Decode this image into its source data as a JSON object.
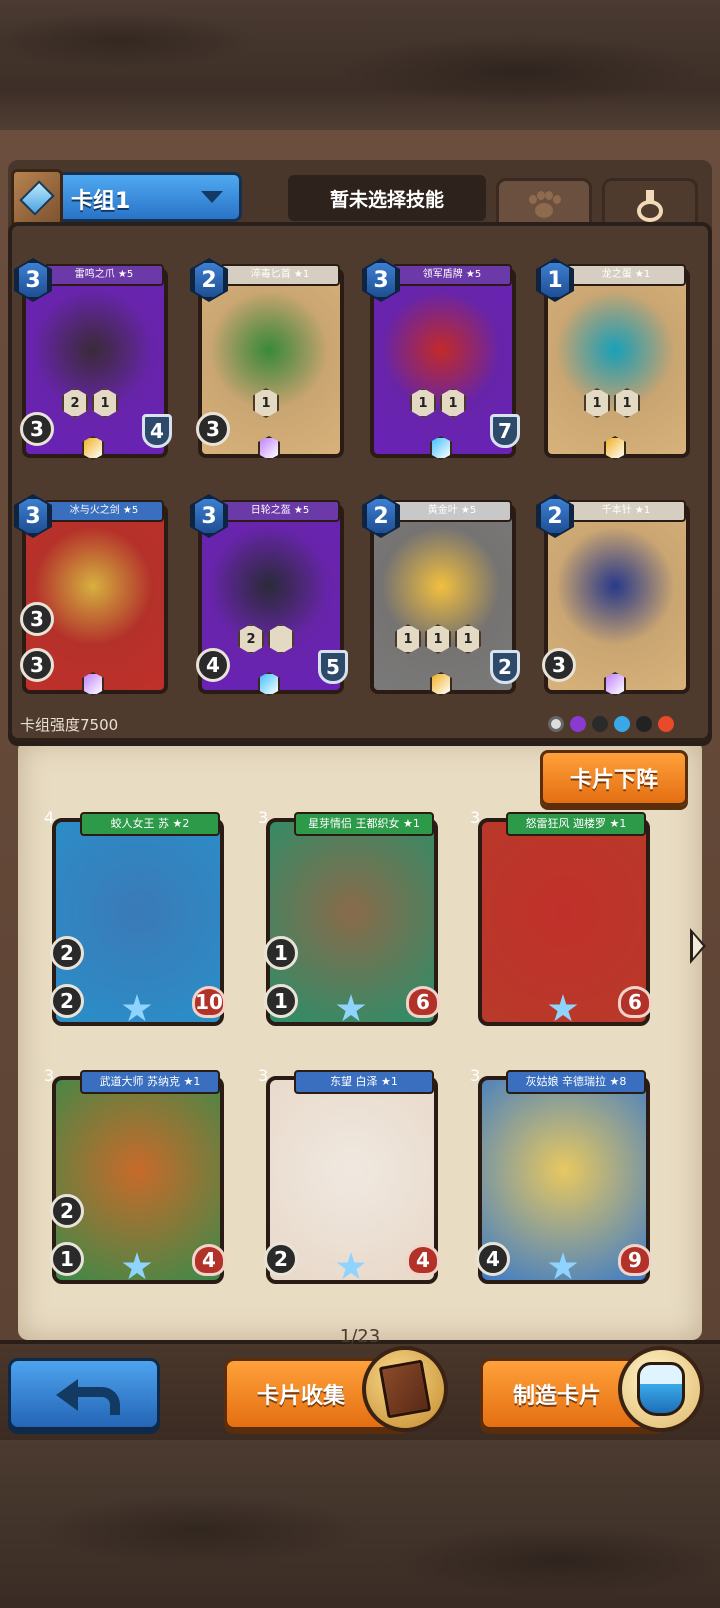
{
  "deck": {
    "name": "卡组1",
    "skill_placeholder": "暂未选择技能",
    "strength_label": "卡组强度7500"
  },
  "tabs": {
    "pets": "paw-icon",
    "potions": "flask-icon"
  },
  "deck_cards": [
    {
      "name": "雷鸣之爪 ★5",
      "cost": "3",
      "left": "3",
      "right": "4",
      "icons": [
        "2",
        "1"
      ],
      "frame": "#6a22b8",
      "banner": "#6c3aa8",
      "rightType": "shield"
    },
    {
      "name": "淬毒匕首 ★1",
      "cost": "2",
      "left": "3",
      "right": "",
      "icons": [
        "1"
      ],
      "frame": "#d8b27a",
      "banner": "#d6cec0",
      "rightType": "none"
    },
    {
      "name": "领军盾牌 ★5",
      "cost": "3",
      "left": "",
      "right": "7",
      "icons": [
        "1",
        "1"
      ],
      "frame": "#6a22b8",
      "banner": "#6c3aa8",
      "rightType": "shield"
    },
    {
      "name": "龙之蛋 ★1",
      "cost": "1",
      "left": "",
      "right": "",
      "icons": [
        "1",
        "1"
      ],
      "frame": "#d8b27a",
      "banner": "#d6cec0",
      "rightType": "none"
    },
    {
      "name": "冰与火之剑 ★5",
      "cost": "3",
      "left": "3",
      "right": "",
      "icons": [],
      "frame": "#c0302a",
      "banner": "#3a6fc0",
      "rightType": "none"
    },
    {
      "name": "日轮之盔 ★5",
      "cost": "3",
      "left": "4",
      "right": "5",
      "icons": [
        "2",
        ""
      ],
      "frame": "#6a22b8",
      "banner": "#6c3aa8",
      "rightType": "shield"
    },
    {
      "name": "黄金叶 ★5",
      "cost": "2",
      "left": "",
      "right": "2",
      "icons": [
        "1",
        "1",
        "1"
      ],
      "frame": "#7a7a7a",
      "banner": "#c8c8c8",
      "rightType": "shield"
    },
    {
      "name": "千本针 ★1",
      "cost": "2",
      "left": "3",
      "right": "",
      "icons": [],
      "frame": "#d8b27a",
      "banner": "#d6cec0",
      "rightType": "none"
    }
  ],
  "deck_cards_extra_left": [
    "3",
    "3"
  ],
  "remove_button": "卡片下阵",
  "collection": [
    {
      "name": "蛟人女王 苏 ★2",
      "cost": "4",
      "left": "2",
      "left2": "2",
      "right": "10",
      "frame": "#2a8fc8",
      "banner": "#2d9a4a"
    },
    {
      "name": "星芽情侣 王都织女 ★1",
      "cost": "3",
      "left": "1",
      "left2": "1",
      "right": "6",
      "frame": "#2a8f6a",
      "banner": "#2d9a4a"
    },
    {
      "name": "怒雷狂风 迦楼罗 ★1",
      "cost": "3",
      "left": "",
      "left2": "",
      "right": "6",
      "frame": "#b83a2a",
      "banner": "#2d9a4a"
    },
    {
      "name": "武道大师 苏纳克 ★1",
      "cost": "3",
      "left": "2",
      "left2": "1",
      "right": "4",
      "frame": "#3a8a4a",
      "banner": "#3a6fc0"
    },
    {
      "name": "东望 白泽 ★1",
      "cost": "3",
      "left": "",
      "left2": "2",
      "right": "4",
      "frame": "#e8d8c8",
      "banner": "#3a6fc0"
    },
    {
      "name": "灰姑娘 辛德瑞拉 ★8",
      "cost": "3",
      "left": "",
      "left2": "4",
      "right": "9",
      "frame": "#3a7ac8",
      "banner": "#3a6fc0"
    }
  ],
  "page_indicator": "1/23",
  "bottom": {
    "collect_label": "卡片收集",
    "craft_label": "制造卡片"
  },
  "colors": {
    "accent_blue": "#2a73c8",
    "accent_orange": "#e46f12",
    "panel_brown": "#4f3a2e"
  }
}
